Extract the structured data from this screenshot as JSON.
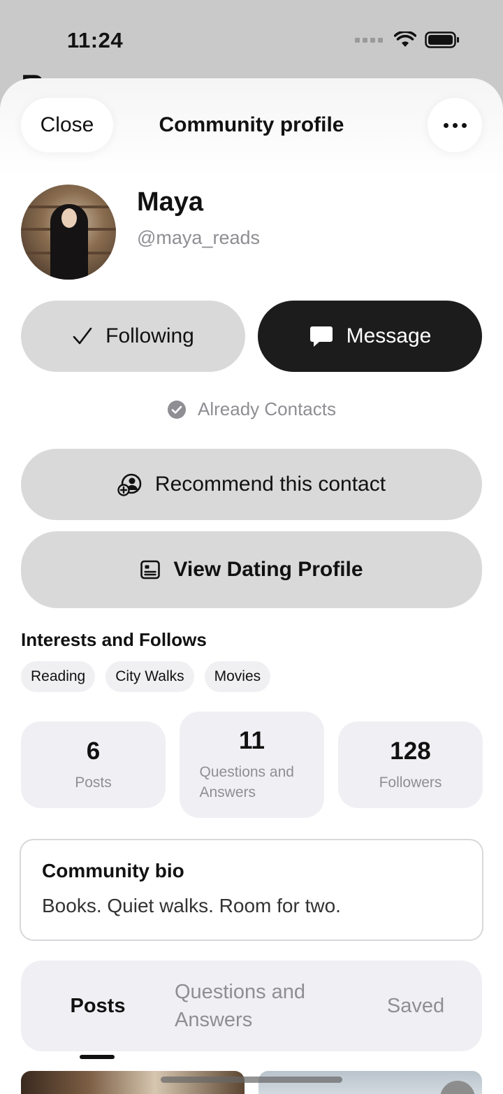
{
  "status_bar": {
    "time": "11:24"
  },
  "background_title": "R",
  "header": {
    "close_label": "Close",
    "title": "Community profile",
    "more_icon": "ellipsis-icon"
  },
  "profile": {
    "name": "Maya",
    "handle": "@maya_reads"
  },
  "actions": {
    "following_label": "Following",
    "message_label": "Message"
  },
  "contacts_status": "Already Contacts",
  "recommend_label": "Recommend this contact",
  "dating_label": "View Dating Profile",
  "interests": {
    "title": "Interests and Follows",
    "chips": [
      "Reading",
      "City Walks",
      "Movies"
    ]
  },
  "stats": [
    {
      "value": "6",
      "label": "Posts"
    },
    {
      "value": "11",
      "label": "Questions and Answers"
    },
    {
      "value": "128",
      "label": "Followers"
    }
  ],
  "bio": {
    "title": "Community bio",
    "text": "Books. Quiet walks. Room for two."
  },
  "tabs": [
    {
      "label": "Posts",
      "active": true
    },
    {
      "label": "Questions and Answers",
      "active": false
    },
    {
      "label": "Saved",
      "active": false
    }
  ],
  "colors": {
    "primary_dark": "#1c1c1c",
    "button_gray": "#d9d9d9",
    "muted_text": "#8e8e93"
  }
}
